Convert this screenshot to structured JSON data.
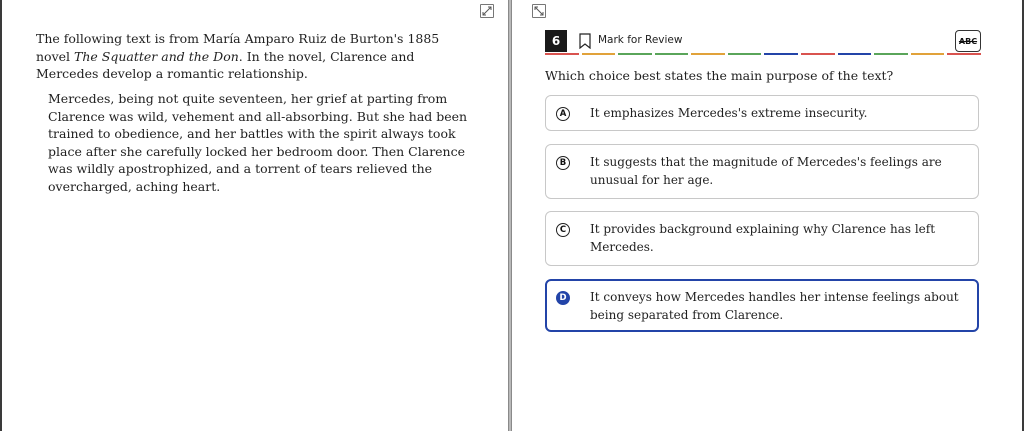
{
  "passage_pane": {
    "intro_prefix": "The following text is from María Amparo Ruiz de Burton's 1885 novel",
    "intro_title": "The Squatter and the Don",
    "intro_suffix": ". In the novel, Clarence and Mercedes develop a romantic relationship.",
    "passage": "Mercedes, being not quite seventeen, her grief at parting from Clarence was wild, vehement and all-absorbing. But she had been trained to obedience, and her battles with the spirit always took place after she carefully locked her bedroom door. Then Clarence was wildly apostrophized, and a torrent of tears relieved the overcharged, aching heart."
  },
  "question_pane": {
    "number": "6",
    "mark_label": "Mark for Review",
    "abc_label": "ABC",
    "prompt": "Which choice best states the main purpose of the text?",
    "dash_colors": [
      "#d9534f",
      "#e1a23a",
      "#5aa55a",
      "#5aa55a",
      "#e1a23a",
      "#5aa55a",
      "#2344a8",
      "#d9534f",
      "#2344a8",
      "#5aa55a",
      "#e1a23a",
      "#d9534f"
    ],
    "choices": [
      {
        "letter": "A",
        "text": "It emphasizes Mercedes's extreme insecurity.",
        "selected": false
      },
      {
        "letter": "B",
        "text": "It suggests that the magnitude of Mercedes's feelings are unusual for her age.",
        "selected": false
      },
      {
        "letter": "C",
        "text": "It provides background explaining why Clarence has left Mercedes.",
        "selected": false
      },
      {
        "letter": "D",
        "text": "It conveys how Mercedes handles her intense feelings about being separated from Clarence.",
        "selected": true
      }
    ]
  }
}
